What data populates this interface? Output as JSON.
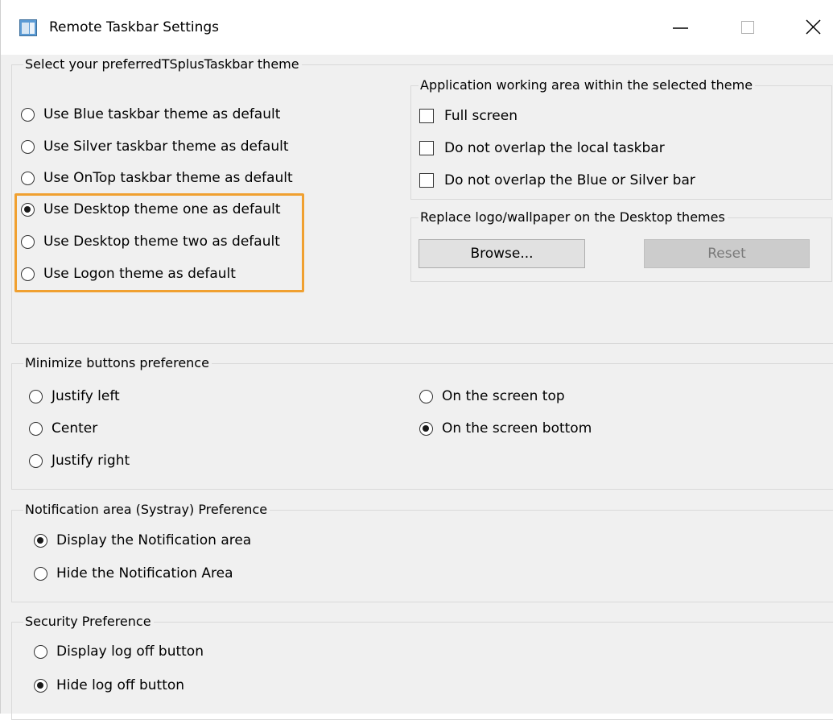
{
  "window": {
    "title": "Remote Taskbar Settings",
    "controls": {
      "minimize": "minimize-icon",
      "maximize": "maximize-icon",
      "close": "close-icon"
    }
  },
  "theme": {
    "legend": "Select your preferredTSplusTaskbar theme",
    "options": [
      {
        "label": "Use Blue taskbar theme as default",
        "selected": false
      },
      {
        "label": "Use Silver taskbar theme as default",
        "selected": false
      },
      {
        "label": "Use OnTop taskbar theme as default",
        "selected": false
      },
      {
        "label": "Use Desktop theme one as default",
        "selected": true
      },
      {
        "label": "Use Desktop theme two as default",
        "selected": false
      },
      {
        "label": "Use Logon theme as default",
        "selected": false
      }
    ],
    "highlight_color": "#f0a030"
  },
  "working_area": {
    "legend": "Application working area within the selected theme",
    "options": [
      {
        "label": "Full screen",
        "checked": false
      },
      {
        "label": "Do not overlap the local taskbar",
        "checked": false
      },
      {
        "label": "Do not overlap the Blue or Silver bar",
        "checked": false
      }
    ]
  },
  "logo": {
    "legend": "Replace logo/wallpaper on the Desktop themes",
    "browse_label": "Browse...",
    "reset_label": "Reset"
  },
  "minimize": {
    "legend": "Minimize buttons preference",
    "align_options": [
      {
        "label": "Justify left",
        "selected": false
      },
      {
        "label": "Center",
        "selected": false
      },
      {
        "label": "Justify right",
        "selected": false
      }
    ],
    "position_options": [
      {
        "label": "On the screen top",
        "selected": false
      },
      {
        "label": "On the screen bottom",
        "selected": true
      }
    ]
  },
  "notification": {
    "legend": "Notification area (Systray) Preference",
    "options": [
      {
        "label": "Display the Notification area",
        "selected": true
      },
      {
        "label": "Hide the Notification Area",
        "selected": false
      }
    ]
  },
  "security": {
    "legend": "Security Preference",
    "options": [
      {
        "label": "Display log off button",
        "selected": false
      },
      {
        "label": "Hide log off button",
        "selected": true
      }
    ]
  }
}
